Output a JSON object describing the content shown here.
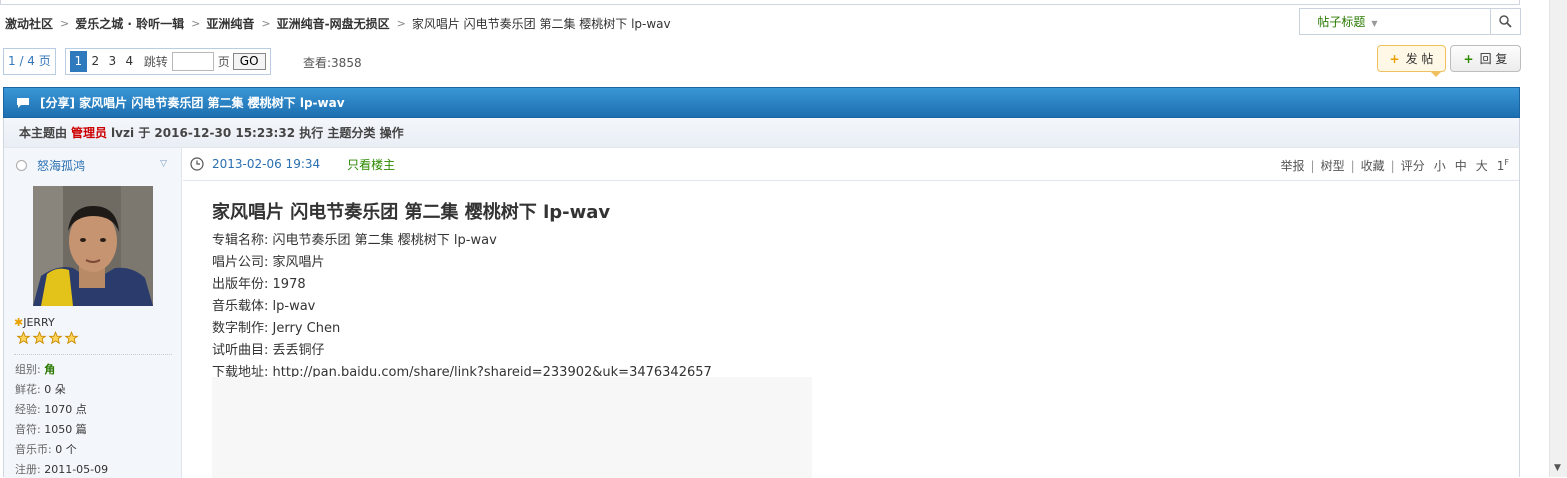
{
  "breadcrumb": [
    {
      "label": "激动社区"
    },
    {
      "label": "爱乐之城 · 聆听一辑"
    },
    {
      "label": "亚洲纯音"
    },
    {
      "label": "亚洲纯音-网盘无损区"
    },
    {
      "label": "家风唱片 闪电节奏乐团 第二集 樱桃树下 lp-wav"
    }
  ],
  "search": {
    "type_label": "帖子标题",
    "placeholder": ""
  },
  "pagination": {
    "total_label": "1 / 4 页",
    "pages": [
      "1",
      "2",
      "3",
      "4"
    ],
    "active_page": "1",
    "jump_label": "跳转",
    "page_unit": "页",
    "go_label": "GO"
  },
  "views_label": "查看:3858",
  "actions": {
    "post_label": "发 帖",
    "reply_label": "回 复"
  },
  "thread": {
    "title": "[分享] 家风唱片 闪电节奏乐团 第二集 樱桃树下 lp-wav",
    "info_prefix": "本主题由",
    "info_admin": "管理员",
    "info_rest": "lvzi 于 2016-12-30 15:23:32 执行 主题分类 操作"
  },
  "author": {
    "name": "怒海孤鸿",
    "rank": "JERRY",
    "stats": [
      {
        "label": "组别:",
        "value": "角"
      },
      {
        "label": "鲜花:",
        "value": "0 朵"
      },
      {
        "label": "经验:",
        "value": "1070 点"
      },
      {
        "label": "音符:",
        "value": "1050 篇"
      },
      {
        "label": "音乐币:",
        "value": "0 个"
      },
      {
        "label": "注册:",
        "value": "2011-05-09"
      }
    ]
  },
  "post": {
    "date": "2013-02-06 19:34",
    "only_op": "只看楼主",
    "tools": [
      "举报",
      "树型",
      "收藏",
      "评分"
    ],
    "font_sizes": [
      "小",
      "中",
      "大"
    ],
    "floor": "1",
    "floor_sup": "F",
    "heading": "家风唱片 闪电节奏乐团 第二集 樱桃树下 lp-wav",
    "fields": [
      {
        "label": "专辑名称:",
        "value": "闪电节奏乐团 第二集 樱桃树下 lp-wav"
      },
      {
        "label": "唱片公司:",
        "value": "家风唱片"
      },
      {
        "label": "出版年份:",
        "value": "1978"
      },
      {
        "label": "音乐载体:",
        "value": "lp-wav"
      },
      {
        "label": "数字制作:",
        "value": "Jerry Chen"
      },
      {
        "label": "试听曲目:",
        "value": "丢丢铜仔"
      },
      {
        "label": "下载地址:",
        "value": "http://pan.baidu.com/share/link?shareid=233902&uk=3476342657"
      }
    ]
  }
}
